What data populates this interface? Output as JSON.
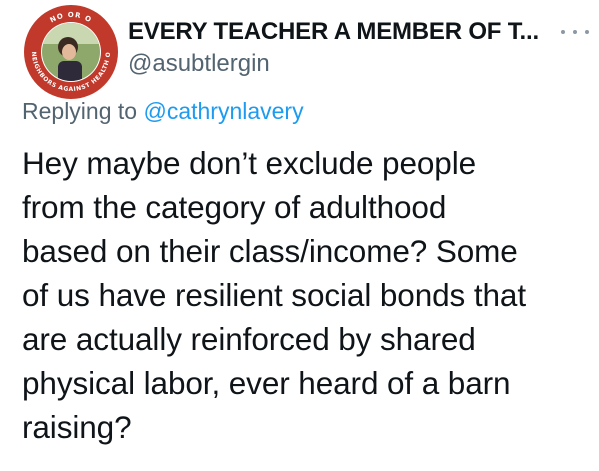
{
  "tweet": {
    "display_name": "EVERY TEACHER A MEMBER OF T...",
    "handle": "@asubtlergin",
    "reply_prefix": "Replying to ",
    "reply_to": "@cathrynlavery",
    "body_lines": [
      "Hey maybe don’t exclude people",
      "from the category of adulthood",
      "based on their class/income? Some",
      "of us have resilient social bonds that",
      "are actually reinforced by shared",
      "physical labor, ever heard of a barn",
      "raising?"
    ],
    "avatar": {
      "ring_top_text": "NO OR O",
      "ring_bottom_text": "NEIGHBORS AGAINST HEALTH O",
      "ring_color": "#c0392b"
    },
    "more_icon": "more-horizontal-icon"
  },
  "colors": {
    "text": "#0f1419",
    "secondary": "#536471",
    "link": "#1d9bf0"
  }
}
